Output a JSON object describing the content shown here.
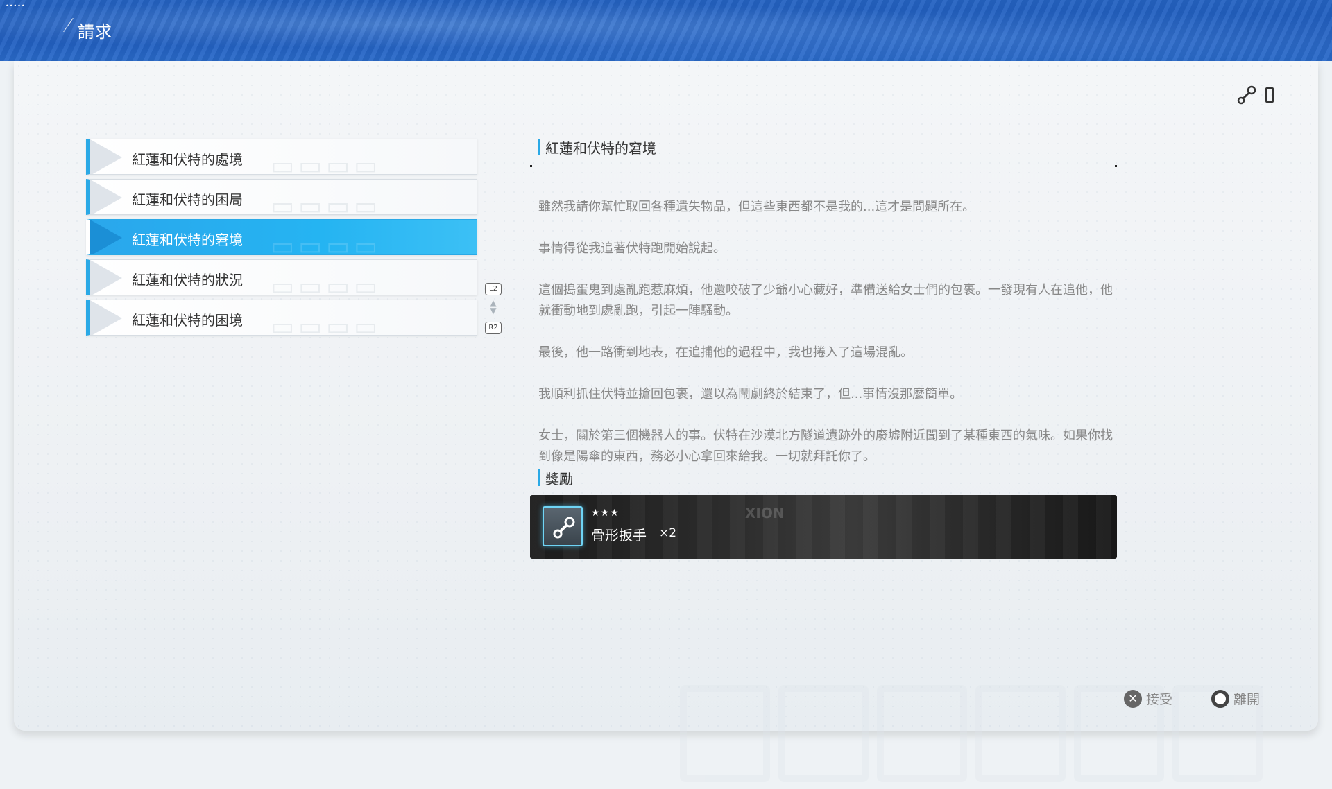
{
  "status": {
    "signal": "•••••"
  },
  "header": {
    "title": "請求"
  },
  "quests": [
    {
      "label": "紅蓮和伏特的處境",
      "active": false
    },
    {
      "label": "紅蓮和伏特的困局",
      "active": false
    },
    {
      "label": "紅蓮和伏特的窘境",
      "active": true
    },
    {
      "label": "紅蓮和伏特的狀況",
      "active": false
    },
    {
      "label": "紅蓮和伏特的困境",
      "active": false
    }
  ],
  "scroll": {
    "up_tag": "L2",
    "down_tag": "R2"
  },
  "detail": {
    "title": "紅蓮和伏特的窘境",
    "paragraphs": [
      "雖然我請你幫忙取回各種遺失物品，但這些東西都不是我的...這才是問題所在。",
      "事情得從我追著伏特跑開始說起。",
      "這個搗蛋鬼到處亂跑惹麻煩，他還咬破了少爺小心藏好，準備送給女士們的包裹。一發現有人在追他，他就衝動地到處亂跑，引起一陣騷動。",
      "最後，他一路衝到地表，在追捕他的過程中，我也捲入了這場混亂。",
      "我順利抓住伏特並搶回包裹，還以為鬧劇終於結束了，但...事情沒那麼簡單。",
      "女士，關於第三個機器人的事。伏特在沙漠北方隧道遺跡外的廢墟附近聞到了某種東西的氣味。如果你找到像是陽傘的東西，務必小心拿回來給我。一切就拜託你了。"
    ]
  },
  "reward": {
    "heading": "獎勵",
    "stars": "★★★",
    "name": "骨形扳手",
    "qty": "×2",
    "bg_text": "XION",
    "icon": "wrench-icon"
  },
  "footer": {
    "accept": "接受",
    "leave": "離開"
  },
  "colors": {
    "accent": "#2aa9e6",
    "banner": "#1e5bbd"
  }
}
